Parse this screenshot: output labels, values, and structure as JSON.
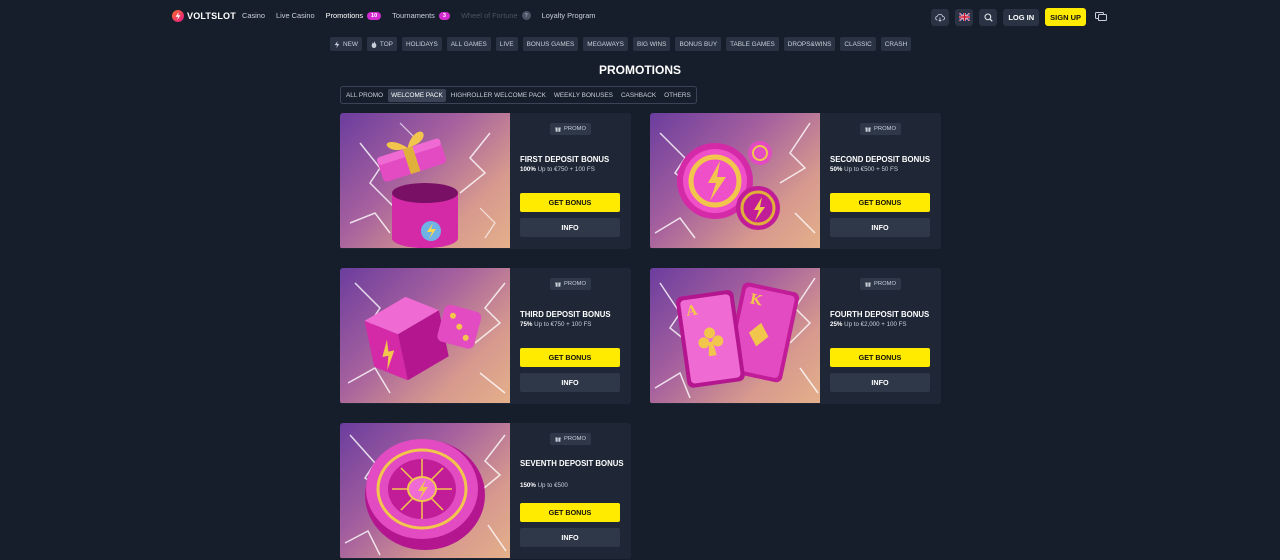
{
  "brand": {
    "name": "VOLTSLOT"
  },
  "nav": [
    {
      "label": "Casino",
      "state": "normal"
    },
    {
      "label": "Live Casino",
      "state": "normal"
    },
    {
      "label": "Promotions",
      "state": "active",
      "badge": "10"
    },
    {
      "label": "Tournaments",
      "state": "normal",
      "badge": "3"
    },
    {
      "label": "Wheel of Fortune",
      "state": "disabled",
      "badge": "?"
    },
    {
      "label": "Loyalty Program",
      "state": "normal"
    }
  ],
  "header_actions": {
    "download_icon": "cloud-download-icon",
    "language_icon": "uk-flag-icon",
    "search_icon": "search-icon",
    "login_label": "LOG IN",
    "signup_label": "SIGN UP",
    "chat_icon": "chat-icon"
  },
  "categories": [
    {
      "label": "NEW",
      "icon": "lightning-icon"
    },
    {
      "label": "TOP",
      "icon": "flame-icon"
    },
    {
      "label": "HOLIDAYS"
    },
    {
      "label": "ALL GAMES"
    },
    {
      "label": "LIVE"
    },
    {
      "label": "BONUS GAMES"
    },
    {
      "label": "MEGAWAYS"
    },
    {
      "label": "BIG WINS"
    },
    {
      "label": "BONUS BUY"
    },
    {
      "label": "TABLE GAMES"
    },
    {
      "label": "DROPS&WINS"
    },
    {
      "label": "CLASSIC"
    },
    {
      "label": "CRASH"
    }
  ],
  "page_title": "PROMOTIONS",
  "tabs": [
    {
      "label": "ALL PROMO",
      "active": false
    },
    {
      "label": "WELCOME PACK",
      "active": true
    },
    {
      "label": "HIGHROLLER WELCOME PACK",
      "active": false
    },
    {
      "label": "WEEKLY BONUSES",
      "active": false
    },
    {
      "label": "CASHBACK",
      "active": false
    },
    {
      "label": "OTHERS",
      "active": false
    }
  ],
  "promos": [
    {
      "tag": "PROMO",
      "title": "FIRST DEPOSIT BONUS",
      "percent": "100%",
      "details": "Up to €750 + 100 FS",
      "cta": "GET BONUS",
      "info": "INFO",
      "art": "gift-box"
    },
    {
      "tag": "PROMO",
      "title": "SECOND DEPOSIT BONUS",
      "percent": "50%",
      "details": "Up to €500 + 50 FS",
      "cta": "GET BONUS",
      "info": "INFO",
      "art": "coins"
    },
    {
      "tag": "PROMO",
      "title": "THIRD DEPOSIT BONUS",
      "percent": "75%",
      "details": "Up to €750 + 100 FS",
      "cta": "GET BONUS",
      "info": "INFO",
      "art": "dice"
    },
    {
      "tag": "PROMO",
      "title": "FOURTH DEPOSIT BONUS",
      "percent": "25%",
      "details": "Up to €2,000 + 100 FS",
      "cta": "GET BONUS",
      "info": "INFO",
      "art": "cards"
    },
    {
      "tag": "PROMO",
      "title": "SEVENTH DEPOSIT BONUS",
      "percent": "150%",
      "details": "Up to €500",
      "cta": "GET BONUS",
      "info": "INFO",
      "art": "roulette"
    }
  ],
  "colors": {
    "background": "#171e2b",
    "card": "#1f2736",
    "accent_yellow": "#ffeb00",
    "badge_pink": "#d42bd0"
  }
}
